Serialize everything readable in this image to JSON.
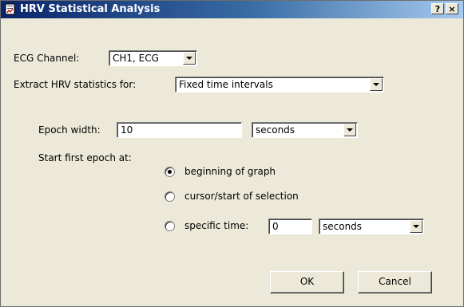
{
  "window": {
    "title": "HRV Statistical Analysis",
    "help_label": "?",
    "close_label": "×"
  },
  "ecg_channel": {
    "label": "ECG Channel:",
    "value": "CH1, ECG"
  },
  "extract": {
    "label": "Extract HRV statistics for:",
    "value": "Fixed time intervals"
  },
  "epoch": {
    "label": "Epoch width:",
    "value": "10",
    "unit": "seconds"
  },
  "start": {
    "label": "Start first epoch at:",
    "options": [
      {
        "label": "beginning of graph",
        "selected": true
      },
      {
        "label": "cursor/start of selection",
        "selected": false
      },
      {
        "label": "specific time:",
        "selected": false
      }
    ],
    "specific_time_value": "0",
    "specific_time_unit": "seconds"
  },
  "buttons": {
    "ok": "OK",
    "cancel": "Cancel"
  },
  "colors": {
    "titlebar_start": "#0a246a",
    "titlebar_end": "#a6caf0",
    "dialog_bg": "#ece9d8"
  },
  "icons": {
    "app": "document-chart-icon",
    "dropdown": "chevron-down-icon"
  }
}
